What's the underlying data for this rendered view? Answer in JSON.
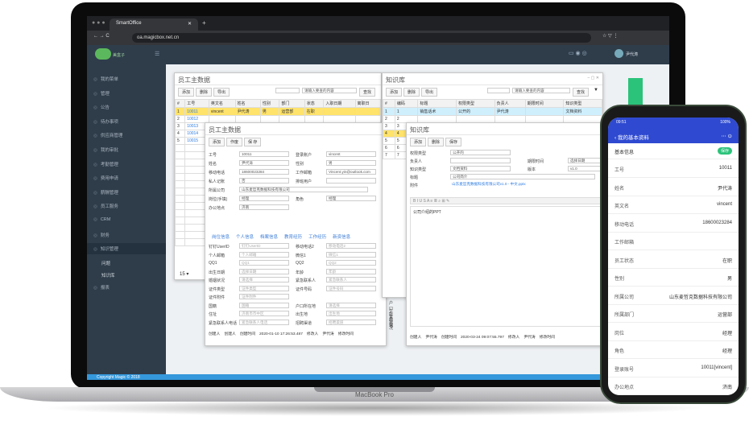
{
  "browser": {
    "tab": "SmartOffice",
    "url": "oa.magicbox.net.cn"
  },
  "app": {
    "logo_text": "美盒子",
    "user": "尹代涛",
    "copyright": "Copyright Magic © 2018",
    "device_brand": "MacBook Pro"
  },
  "sidebar": {
    "items": [
      "我的菜单",
      "管理",
      "公告",
      "待办事项",
      "供应商管理",
      "我的审批",
      "考勤管理",
      "费用申请",
      "薪酬管理",
      "员工服务",
      "CRM",
      "财务",
      "知识管理",
      "报表"
    ],
    "subitems": [
      "问题",
      "知识库"
    ]
  },
  "emp_window": {
    "title": "员工主数据",
    "buttons": [
      "添加",
      "删除",
      "导出"
    ],
    "search_placeholder": "请输入要查的内容",
    "search_btn": "查找",
    "headers": [
      "#",
      "工号",
      "英文名",
      "姓名",
      "性别",
      "部门",
      "状态",
      "入职日期",
      "离职日"
    ],
    "rows": [
      [
        "1",
        "10011",
        "vincent",
        "尹代涛",
        "男",
        "运营部",
        "在职"
      ],
      [
        "2",
        "10012",
        "",
        "",
        "",
        "",
        ""
      ],
      [
        "3",
        "10013",
        "",
        "",
        "",
        "",
        ""
      ],
      [
        "4",
        "10014",
        "",
        "",
        "",
        "",
        ""
      ],
      [
        "5",
        "10015",
        "",
        "",
        "",
        "",
        ""
      ]
    ],
    "pager": "15"
  },
  "emp_detail": {
    "title": "员工主数据",
    "buttons": [
      "添加",
      "作废",
      "保 存"
    ],
    "fields": [
      [
        "工号",
        "10011"
      ],
      [
        "登录账户",
        "vincent"
      ],
      [
        "姓名",
        "尹代涛"
      ],
      [
        "性别",
        "男"
      ],
      [
        "移动电话",
        "18600023284"
      ],
      [
        "工作邮箱",
        "Vincent.yin@outlook.com"
      ],
      [
        "私人记账",
        "否"
      ],
      [
        "排班用户",
        ""
      ],
      [
        "所属公司",
        "山东麦哲克数据科技有限公司"
      ],
      [
        "",
        ""
      ],
      [
        "岗位(手填)",
        "经理"
      ],
      [
        "角色",
        "经理"
      ],
      [
        "办公地点",
        "济南"
      ]
    ],
    "tabs": [
      "岗位信息",
      "个人信息",
      "档案信息",
      "教育经历",
      "工作经历",
      "新资信息"
    ],
    "personal": [
      [
        "钉钉UserID",
        "钉钉UserID"
      ],
      [
        "移动电话2",
        "移动电话2"
      ],
      [
        "个人邮箱",
        "个人邮箱"
      ],
      [
        "微信1",
        "微信1"
      ],
      [
        "QQ1",
        "QQ1"
      ],
      [
        "QQ2",
        "QQ2"
      ],
      [
        "出生日期",
        "选择日期"
      ],
      [
        "年龄",
        "年龄"
      ],
      [
        "婚姻状况",
        "请选择"
      ],
      [
        "紧急联系人",
        "紧急联系人"
      ],
      [
        "证件类型",
        "证件类型"
      ],
      [
        "证件号码",
        "证件号码"
      ],
      [
        "证件附件",
        "证件附件"
      ],
      [
        "",
        ""
      ],
      [
        "国籍",
        "国籍"
      ],
      [
        "户口所在地",
        "请选择"
      ],
      [
        "住址",
        "济南市市中区"
      ],
      [
        "出生地",
        "出生地"
      ],
      [
        "紧急联系人电话",
        "紧急联系人电话"
      ],
      [
        "招聘渠道",
        "招聘渠道"
      ]
    ],
    "extra": [
      "户口所在地",
      "生育状况",
      "血型"
    ],
    "footer": [
      "创建人",
      "创建人",
      "创建时间",
      "2020-01-10 17:26:53.487",
      "修改人",
      "尹代涛",
      "修改时间"
    ]
  },
  "kb_window": {
    "title": "知识库",
    "buttons": [
      "添加",
      "删除",
      "导出"
    ],
    "search_placeholder": "请输入要查的内容",
    "search_btn": "查找",
    "headers": [
      "#",
      "编码",
      "标题",
      "权限类型",
      "负责人",
      "期限时间",
      "知识类型"
    ],
    "rows": [
      [
        "1",
        "1",
        "销售话术",
        "公开的",
        "尹代涛",
        "",
        "文档资料"
      ],
      [
        "2",
        "2"
      ],
      [
        "3",
        "3"
      ],
      [
        "4",
        "4"
      ],
      [
        "5",
        "5"
      ],
      [
        "6",
        "6"
      ],
      [
        "7",
        "7"
      ]
    ]
  },
  "kb_detail": {
    "title": "知识库",
    "buttons": [
      "添加",
      "删除",
      "保存"
    ],
    "fields": [
      [
        "权限类型",
        "公开的"
      ],
      [
        "负责人",
        ""
      ],
      [
        "期限时间",
        "选择日期"
      ],
      [
        "知识类型",
        "文档资料"
      ],
      [
        "版本",
        "v1.0"
      ],
      [
        "标题",
        "公司简介"
      ],
      [
        "附件",
        "山东麦哲克数据科技有限公司v1.0 - 中文.pptx"
      ]
    ],
    "editor_text": "公司介绍的PPT",
    "footer": [
      "创建人",
      "尹代涛",
      "创建时间",
      "2020-03-24 09:07:55.797",
      "修改人",
      "尹代涛",
      "修改时间"
    ]
  },
  "phone": {
    "time": "09:51",
    "battery": "100%",
    "title": "我的基本资料",
    "section": "基本信息",
    "save": "保存",
    "rows": [
      [
        "工号",
        "10011"
      ],
      [
        "姓名",
        "尹代涛"
      ],
      [
        "英文名",
        "vincent"
      ],
      [
        "移动电话",
        "18600023284"
      ],
      [
        "工作邮箱",
        ""
      ],
      [
        "员工状态",
        "在职"
      ],
      [
        "性别",
        "男"
      ],
      [
        "所属公司",
        "山东麦哲克数据科技有限公司"
      ],
      [
        "所属部门",
        "运营部"
      ],
      [
        "岗位",
        "经理"
      ],
      [
        "角色",
        "经理"
      ],
      [
        "登录账号",
        "10011[vincent]"
      ],
      [
        "办公地点",
        "济南"
      ]
    ]
  }
}
